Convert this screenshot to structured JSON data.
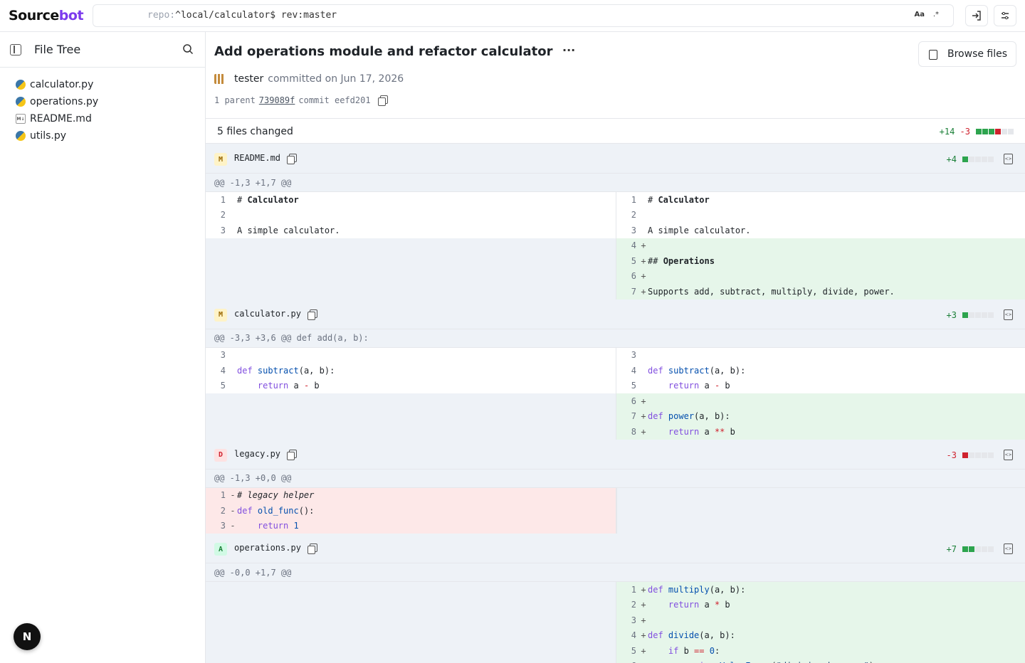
{
  "header": {
    "logo_main": "Source",
    "logo_accent": "bot",
    "search_prefix": "repo:",
    "search_query": "^local/calculator$ rev:master",
    "case_label": "Aa",
    "regex_label": ".*"
  },
  "sidebar": {
    "title": "File Tree",
    "items": [
      {
        "label": "calculator.py",
        "icon": "python-icon"
      },
      {
        "label": "operations.py",
        "icon": "python-icon"
      },
      {
        "label": "README.md",
        "icon": "markdown-icon"
      },
      {
        "label": "utils.py",
        "icon": "python-icon"
      }
    ]
  },
  "commit": {
    "title": "Add operations module and refactor calculator",
    "more_label": "···",
    "browse_label": "Browse files",
    "author": "tester",
    "when": "committed on Jun 17, 2026",
    "parent_prefix": "1 parent",
    "parent_sha": "739089f",
    "commit_prefix": "commit",
    "commit_sha": "eefd201",
    "files_changed": "5 files changed",
    "total_add": "+14",
    "total_del": "-3"
  },
  "files": [
    {
      "badge": "M",
      "name": "README.md",
      "add": "+4",
      "del": "",
      "hunk": "@@ -1,3 +1,7 @@"
    },
    {
      "badge": "M",
      "name": "calculator.py",
      "add": "+3",
      "del": "",
      "hunk": "@@ -3,3 +3,6 @@ def add(a, b):"
    },
    {
      "badge": "D",
      "name": "legacy.py",
      "add": "",
      "del": "-3",
      "hunk": "@@ -1,3 +0,0 @@"
    },
    {
      "badge": "A",
      "name": "operations.py",
      "add": "+7",
      "del": "",
      "hunk": "@@ -0,0 +1,7 @@"
    }
  ],
  "fab": {
    "label": "N"
  }
}
